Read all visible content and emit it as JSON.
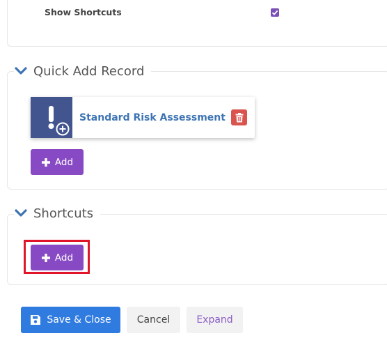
{
  "settings": {
    "show_shortcuts_label": "Show Shortcuts",
    "show_shortcuts_checked": true
  },
  "quick_add": {
    "title": "Quick Add Record",
    "records": [
      {
        "name": "Standard Risk Assessment",
        "icon": "exclamation-plus-icon"
      }
    ],
    "add_label": "Add"
  },
  "shortcuts": {
    "title": "Shortcuts",
    "add_label": "Add"
  },
  "footer": {
    "save_label": "Save & Close",
    "cancel_label": "Cancel",
    "expand_label": "Expand"
  },
  "colors": {
    "accent_purple": "#8849c4",
    "primary_blue": "#2f7be0",
    "record_icon_bg": "#43558f",
    "record_text": "#3e74b3",
    "danger": "#d9534f",
    "highlight": "#e0152a"
  }
}
